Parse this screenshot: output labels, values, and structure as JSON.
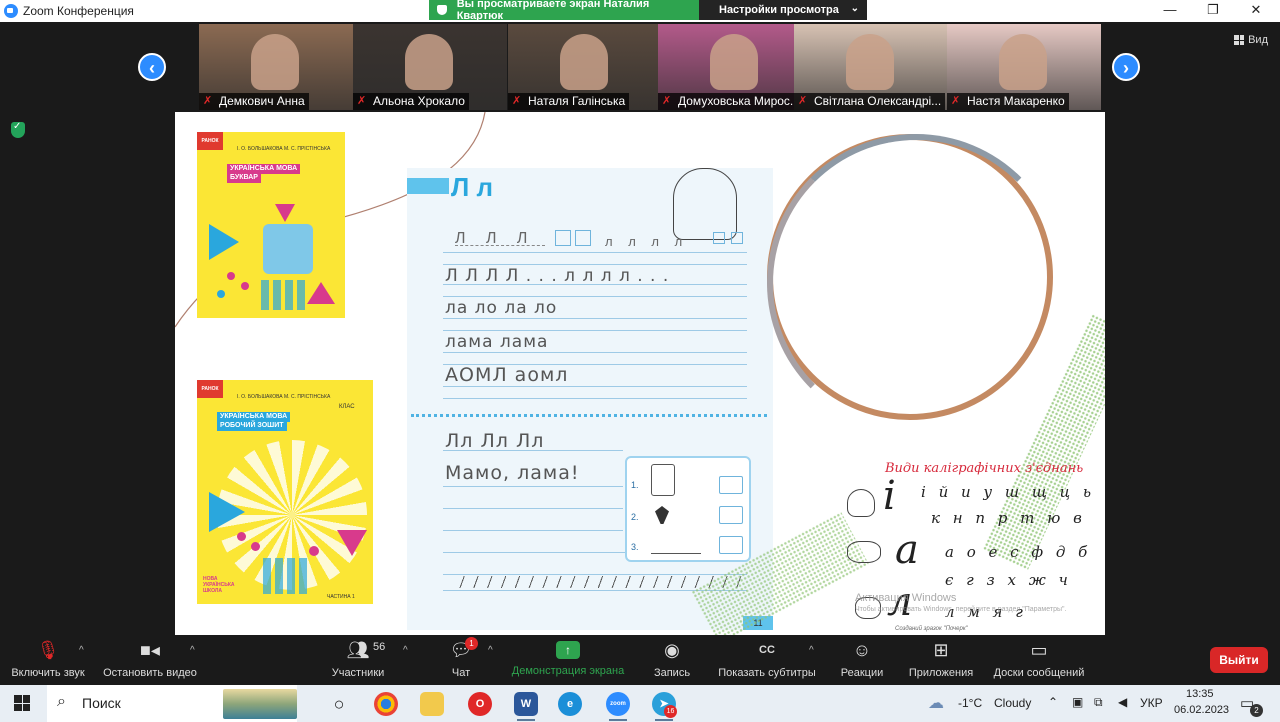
{
  "window": {
    "title": "Zoom Конференция",
    "minimize": "—",
    "maximize": "❐",
    "close": "✕"
  },
  "banner": {
    "viewing": "Вы просматриваете экран Наталия Квартюк",
    "view_settings": "Настройки просмотра"
  },
  "view_button": "Вид",
  "participants_strip": [
    {
      "name": "Демкович Анна",
      "bg": "#8b6a52"
    },
    {
      "name": "Альона Хрокало",
      "bg": "#3b3430"
    },
    {
      "name": "Наталя Галінська",
      "bg": "#5a4a3e"
    },
    {
      "name": "Домуховська Мирос...",
      "bg": "#b35a8a"
    },
    {
      "name": "Світлана Олександрі...",
      "bg": "#d7c2b3"
    },
    {
      "name": "Настя Макаренко",
      "bg": "#e6c9c4"
    }
  ],
  "slide": {
    "book1": {
      "brand": "РАНОК",
      "authors": "І. О. БОЛЬШАКОВА  М. С. ПРІСТІНСЬКА",
      "title_line1": "УКРАЇНСЬКА МОВА",
      "title_line2": "БУКВАР"
    },
    "book2": {
      "brand": "РАНОК",
      "authors": "І. О. БОЛЬШАКОВА  М. С. ПРІСТІНСЬКА",
      "title_line1": "УКРАЇНСЬКА МОВА",
      "title_line2": "РОБОЧИЙ ЗОШИТ",
      "class_label": "КЛАС",
      "series": "НОВА УКРАЇНСЬКА ШКОЛА",
      "part": "ЧАСТИНА 1"
    },
    "notebook": {
      "letter_title": "Л л",
      "line1": "Л Л Л Л . . .   л л л л . . .",
      "line2": "ла  ло   ла  ло",
      "line3": "лама  лама",
      "line4": "АОМЛ   аомл",
      "line5": "Лл  Лл  Лл",
      "line6": "Мамо, лама!",
      "ex_nums": [
        "1.",
        "2.",
        "3."
      ],
      "page_number": "11"
    },
    "calligraphy": {
      "title": "Види каліграфічних з'єднань",
      "row1": "і й и у ш щ ц ь",
      "row2": "к н п р т ю в",
      "row3": "а о е с ф д б",
      "row4": "є г з х ж ч",
      "row5": "л м я г",
      "big1": "і",
      "big2": "а",
      "big3": "л",
      "footer": "Созданий зразок \"Почерк\""
    },
    "watermark": {
      "line1": "Активация Windows",
      "line2": "Чтобы активировать Windows, перейдите в раздел \"Параметры\"."
    }
  },
  "toolbar": {
    "unmute": "Включить звук",
    "stop_video": "Остановить видео",
    "participants": "Участники",
    "participants_count": "56",
    "chat": "Чат",
    "chat_badge": "1",
    "share": "Демонстрация экрана",
    "record": "Запись",
    "captions": "Показать субтитры",
    "reactions": "Реакции",
    "apps": "Приложения",
    "whiteboards": "Доски сообщений",
    "end": "Выйти",
    "share_color": "#2ea44f",
    "end_color": "#d92727"
  },
  "taskbar": {
    "search_placeholder": "Поиск",
    "telegram_badge": "16",
    "weather_temp": "-1°C",
    "weather_text": "Cloudy",
    "lang": "УКР",
    "time": "13:35",
    "date": "06.02.2023",
    "notification_count": "2"
  }
}
